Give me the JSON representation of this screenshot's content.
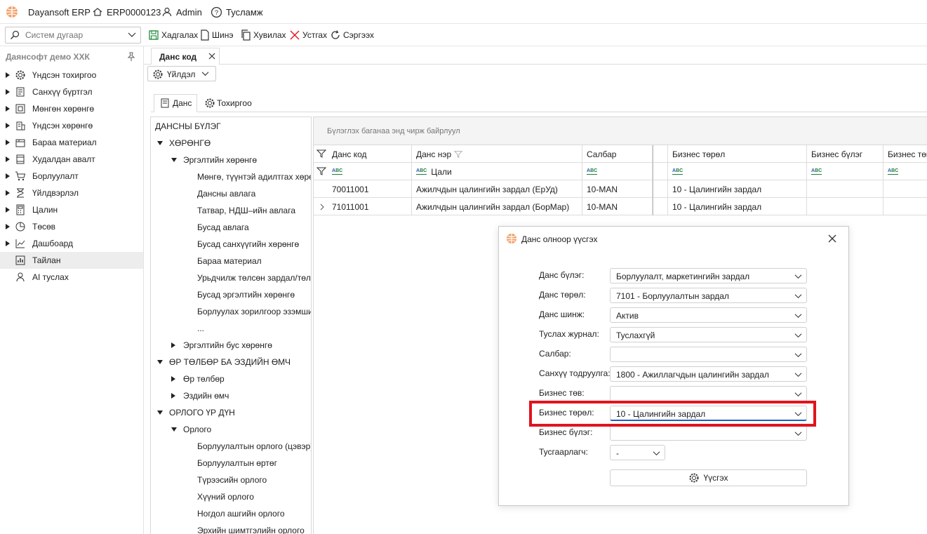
{
  "titlebar": {
    "app_name": "Dayansoft ERP",
    "code": "ERP0000123",
    "user": "Admin",
    "help": "Тусламж"
  },
  "toolbar": {
    "search_placeholder": "Систем дугаар",
    "save": "Хадгалах",
    "new": "Шинэ",
    "copy": "Хувилах",
    "delete": "Устгах",
    "refresh": "Сэргээх"
  },
  "sidebar": {
    "company": "Даянсофт демо ХХК",
    "items": [
      {
        "label": "Үндсэн тохиргоо",
        "icon": "gear-icon"
      },
      {
        "label": "Санхүү бүртгэл",
        "icon": "ledger-icon"
      },
      {
        "label": "Мөнгөн хөрөнгө",
        "icon": "safe-icon"
      },
      {
        "label": "Үндсэн хөрөнгө",
        "icon": "building-icon"
      },
      {
        "label": "Бараа материал",
        "icon": "box-icon"
      },
      {
        "label": "Худалдан авалт",
        "icon": "purchase-icon"
      },
      {
        "label": "Борлуулалт",
        "icon": "cart-icon"
      },
      {
        "label": "Үйлдвэрлэл",
        "icon": "factory-icon"
      },
      {
        "label": "Цалин",
        "icon": "calculator-icon"
      },
      {
        "label": "Төсөв",
        "icon": "pie-chart-icon"
      },
      {
        "label": "Дашбоард",
        "icon": "dashboard-icon"
      },
      {
        "label": "Тайлан",
        "icon": "report-icon"
      },
      {
        "label": "AI туслах",
        "icon": "ai-assistant-icon"
      }
    ]
  },
  "doc_tab": {
    "label": "Данс код"
  },
  "action_dropdown": {
    "label": "Үйлдэл"
  },
  "sub_tabs": {
    "account": "Данс",
    "settings": "Тохиргоо"
  },
  "tree": [
    {
      "label": "ДАНСНЫ БҮЛЭГ",
      "level": 0,
      "toggle": "none"
    },
    {
      "label": "ХӨРӨНГӨ",
      "level": 1,
      "toggle": "down"
    },
    {
      "label": "Эргэлтийн хөрөнгө",
      "level": 2,
      "toggle": "down"
    },
    {
      "label": "Мөнгө, түүнтэй адилтгах хөрөнгө",
      "level": 3,
      "toggle": "none"
    },
    {
      "label": "Дансны авлага",
      "level": 3,
      "toggle": "none"
    },
    {
      "label": "Татвар, НДШ–ийн авлага",
      "level": 3,
      "toggle": "none"
    },
    {
      "label": "Бусад авлага",
      "level": 3,
      "toggle": "none"
    },
    {
      "label": "Бусад санхүүгийн хөрөнгө",
      "level": 3,
      "toggle": "none"
    },
    {
      "label": "Бараа материал",
      "level": 3,
      "toggle": "none"
    },
    {
      "label": "Урьдчилж төлсөн зардал/төлбөр",
      "level": 3,
      "toggle": "none"
    },
    {
      "label": "Бусад эргэлтийн хөрөнгө",
      "level": 3,
      "toggle": "none"
    },
    {
      "label": "Борлуулах зорилгоор эзэмшиж буй",
      "level": 3,
      "toggle": "none"
    },
    {
      "label": "...",
      "level": 3,
      "toggle": "none"
    },
    {
      "label": "Эргэлтийн бус хөрөнгө",
      "level": 2,
      "toggle": "right"
    },
    {
      "label": "ӨР ТӨЛБӨР БА ЭЗДИЙН ӨМЧ",
      "level": 1,
      "toggle": "down"
    },
    {
      "label": "Өр төлбөр",
      "level": 2,
      "toggle": "right"
    },
    {
      "label": "Эздийн өмч",
      "level": 2,
      "toggle": "right"
    },
    {
      "label": "ОРЛОГО ҮР ДҮН",
      "level": 1,
      "toggle": "down"
    },
    {
      "label": "Орлого",
      "level": 2,
      "toggle": "down"
    },
    {
      "label": "Борлуулалтын орлого (цэвэр)",
      "level": 3,
      "toggle": "none"
    },
    {
      "label": "Борлуулалтын өртөг",
      "level": 3,
      "toggle": "none"
    },
    {
      "label": "Түрээсийн орлого",
      "level": 3,
      "toggle": "none"
    },
    {
      "label": "Хүүний орлого",
      "level": 3,
      "toggle": "none"
    },
    {
      "label": "Ногдол ашгийн орлого",
      "level": 3,
      "toggle": "none"
    },
    {
      "label": "Эрхийн шимтгэлийн орлого",
      "level": 3,
      "toggle": "none"
    }
  ],
  "grid": {
    "group_hint": "Бүлэглэх баганаа энд чирж байрлуул",
    "columns": [
      "Данс код",
      "Данс нэр",
      "Салбар",
      "",
      "Бизнес төрөл",
      "Бизнес бүлэг",
      "Бизнес төв"
    ],
    "filter_name_value": "Цали",
    "rows": [
      [
        "70011001",
        "Ажилчдын цалингийн зардал (ЕрУд)",
        "10-MAN",
        "",
        "10 - Цалингийн зардал",
        "",
        ""
      ],
      [
        "71011001",
        "Ажилчдын цалингийн зардал (БорМар)",
        "10-MAN",
        "",
        "10 - Цалингийн зардал",
        "",
        ""
      ]
    ]
  },
  "dialog": {
    "title": "Данс олноор үүсгэх",
    "fields": [
      {
        "label": "Данс бүлэг:",
        "value": "Борлуулалт, маркетингийн зардал"
      },
      {
        "label": "Данс төрөл:",
        "value": "7101 - Борлуулалтын зардал"
      },
      {
        "label": "Данс шинж:",
        "value": "Актив"
      },
      {
        "label": "Туслах журнал:",
        "value": "Туслахгүй"
      },
      {
        "label": "Салбар:",
        "value": ""
      },
      {
        "label": "Санхүү тодруулга:",
        "value": "1800 - Ажиллагчдын цалингийн зардал"
      },
      {
        "label": "Бизнес төв:",
        "value": ""
      },
      {
        "label": "Бизнес төрөл:",
        "value": "10 - Цалингийн зардал"
      },
      {
        "label": "Бизнес бүлэг:",
        "value": ""
      }
    ],
    "separator_label": "Тусгаарлагч:",
    "separator_value": "-",
    "create_button": "Үүсгэх"
  }
}
